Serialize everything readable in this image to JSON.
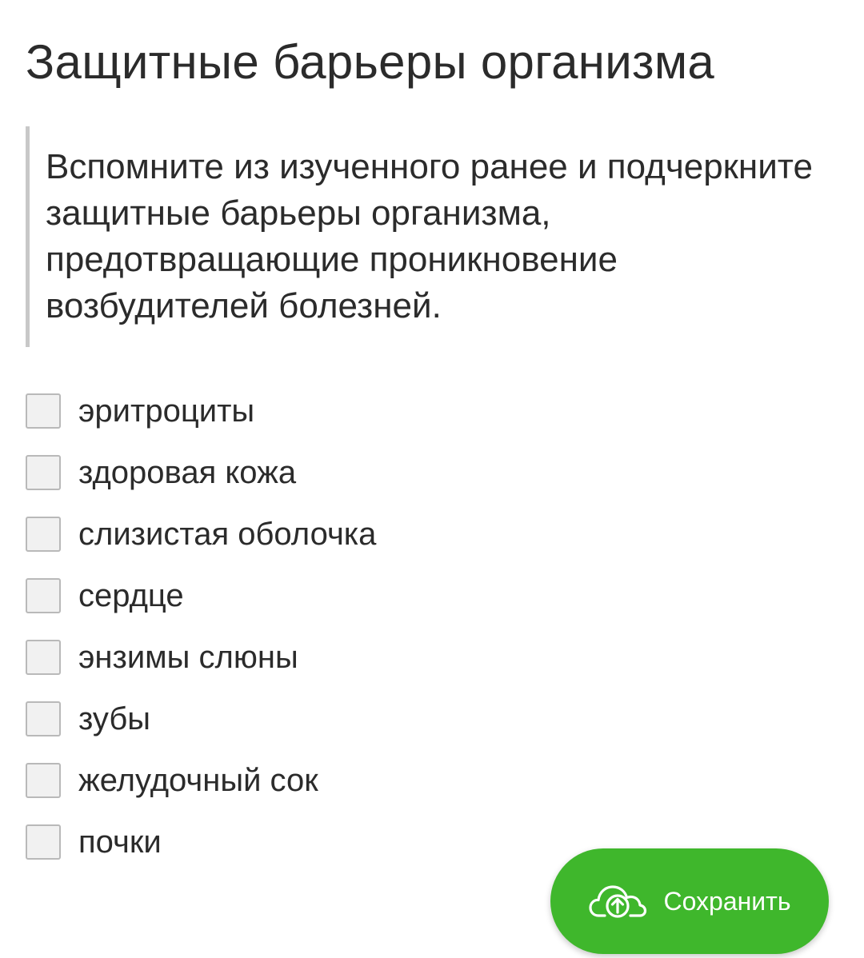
{
  "title": "Защитные барьеры организма",
  "instruction": "Вспомните из изученного ранее и подчеркните защитные барьеры организма, предотвращающие проникновение возбудителей болезней.",
  "options": [
    {
      "label": "эритроциты",
      "checked": false
    },
    {
      "label": "здоровая кожа",
      "checked": false
    },
    {
      "label": "слизистая оболочка",
      "checked": false
    },
    {
      "label": "сердце",
      "checked": false
    },
    {
      "label": "энзимы слюны",
      "checked": false
    },
    {
      "label": "зубы",
      "checked": false
    },
    {
      "label": "желудочный сок",
      "checked": false
    },
    {
      "label": "почки",
      "checked": false
    }
  ],
  "save_button": {
    "label": "Сохранить",
    "icon": "cloud-upload-icon",
    "color": "#3fb72c"
  }
}
